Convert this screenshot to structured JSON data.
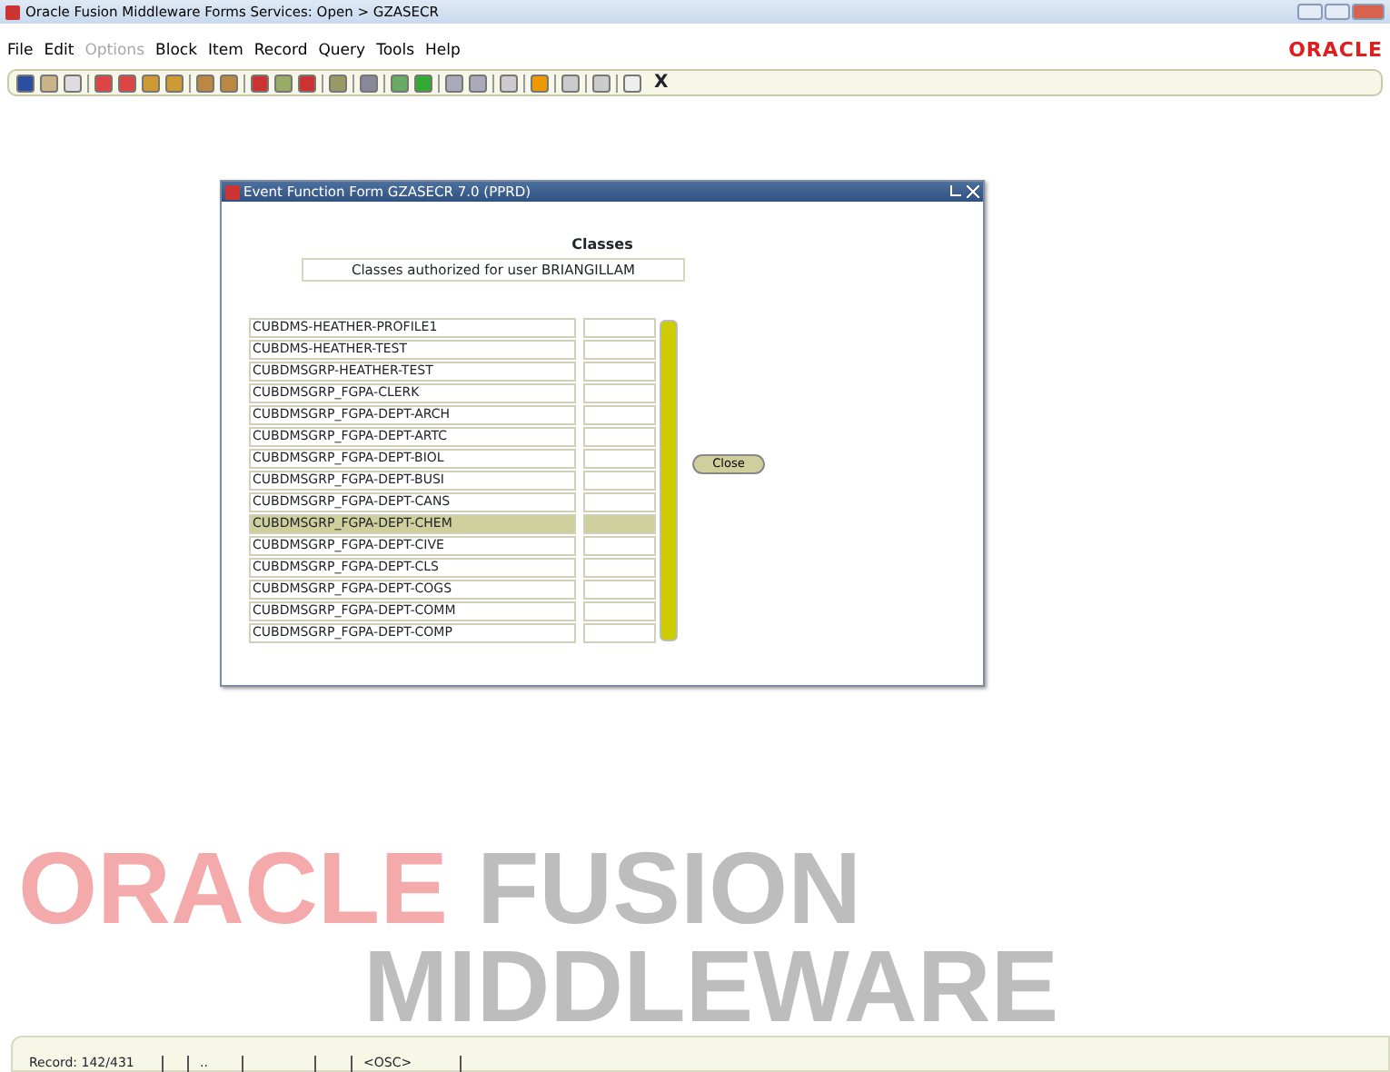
{
  "window": {
    "title": "Oracle Fusion Middleware Forms Services:  Open > GZASECR"
  },
  "menu": [
    {
      "label": "File",
      "disabled": false
    },
    {
      "label": "Edit",
      "disabled": false
    },
    {
      "label": "Options",
      "disabled": true
    },
    {
      "label": "Block",
      "disabled": false
    },
    {
      "label": "Item",
      "disabled": false
    },
    {
      "label": "Record",
      "disabled": false
    },
    {
      "label": "Query",
      "disabled": false
    },
    {
      "label": "Tools",
      "disabled": false
    },
    {
      "label": "Help",
      "disabled": false
    }
  ],
  "logo": "ORACLE",
  "toolbar_exit": "X",
  "form": {
    "title": "Event Function Form  GZASECR  7.0  (PPRD)",
    "heading": "Classes",
    "subtitle": "Classes authorized for user BRIANGILLAM",
    "rows": [
      {
        "name": "CUBDMS-HEATHER-PROFILE1",
        "selected": false
      },
      {
        "name": "CUBDMS-HEATHER-TEST",
        "selected": false
      },
      {
        "name": "CUBDMSGRP-HEATHER-TEST",
        "selected": false
      },
      {
        "name": "CUBDMSGRP_FGPA-CLERK",
        "selected": false
      },
      {
        "name": "CUBDMSGRP_FGPA-DEPT-ARCH",
        "selected": false
      },
      {
        "name": "CUBDMSGRP_FGPA-DEPT-ARTC",
        "selected": false
      },
      {
        "name": "CUBDMSGRP_FGPA-DEPT-BIOL",
        "selected": false
      },
      {
        "name": "CUBDMSGRP_FGPA-DEPT-BUSI",
        "selected": false
      },
      {
        "name": "CUBDMSGRP_FGPA-DEPT-CANS",
        "selected": false
      },
      {
        "name": "CUBDMSGRP_FGPA-DEPT-CHEM",
        "selected": true
      },
      {
        "name": "CUBDMSGRP_FGPA-DEPT-CIVE",
        "selected": false
      },
      {
        "name": "CUBDMSGRP_FGPA-DEPT-CLS",
        "selected": false
      },
      {
        "name": "CUBDMSGRP_FGPA-DEPT-COGS",
        "selected": false
      },
      {
        "name": "CUBDMSGRP_FGPA-DEPT-COMM",
        "selected": false
      },
      {
        "name": "CUBDMSGRP_FGPA-DEPT-COMP",
        "selected": false
      }
    ],
    "close_button": "Close"
  },
  "background_brand": {
    "line1": [
      "ORACLE",
      "FUSION"
    ],
    "line2": "MIDDLEWARE"
  },
  "status_bar": {
    "record": "Record: 142/431",
    "dots": "..",
    "mode": "<OSC>"
  }
}
